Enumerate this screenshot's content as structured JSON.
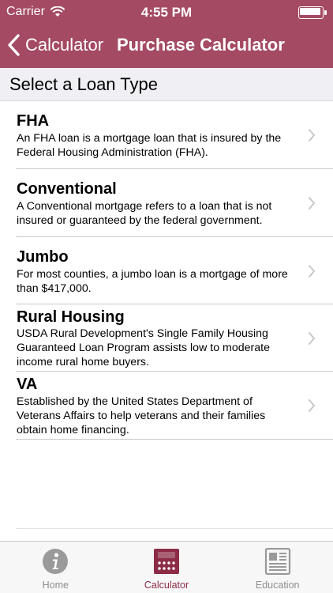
{
  "status_bar": {
    "carrier": "Carrier",
    "time": "4:55 PM"
  },
  "nav": {
    "back_label": "Calculator",
    "title": "Purchase Calculator"
  },
  "section_header": "Select a Loan Type",
  "loan_types": [
    {
      "title": "FHA",
      "description": "An FHA loan is a mortgage loan that is insured by the Federal Housing Administration (FHA)."
    },
    {
      "title": "Conventional",
      "description": "A Conventional mortgage refers to a loan that is not insured or guaranteed by the federal government."
    },
    {
      "title": "Jumbo",
      "description": "For most counties, a jumbo loan is a mortgage of more than $417,000."
    },
    {
      "title": "Rural Housing",
      "description": "USDA Rural Development's Single Family Housing Guaranteed Loan Program assists low to moderate income rural home buyers."
    },
    {
      "title": "VA",
      "description": "Established by the United States Department of Veterans Affairs to help veterans and their families obtain home financing."
    }
  ],
  "tab_bar": {
    "tabs": [
      {
        "label": "Home",
        "icon": "info-icon",
        "active": false
      },
      {
        "label": "Calculator",
        "icon": "calculator-icon",
        "active": true
      },
      {
        "label": "Education",
        "icon": "newspaper-icon",
        "active": false
      }
    ]
  },
  "colors": {
    "brand": "#a44a62",
    "active_tab": "#8c2c47",
    "inactive_tab": "#8e8e93"
  }
}
